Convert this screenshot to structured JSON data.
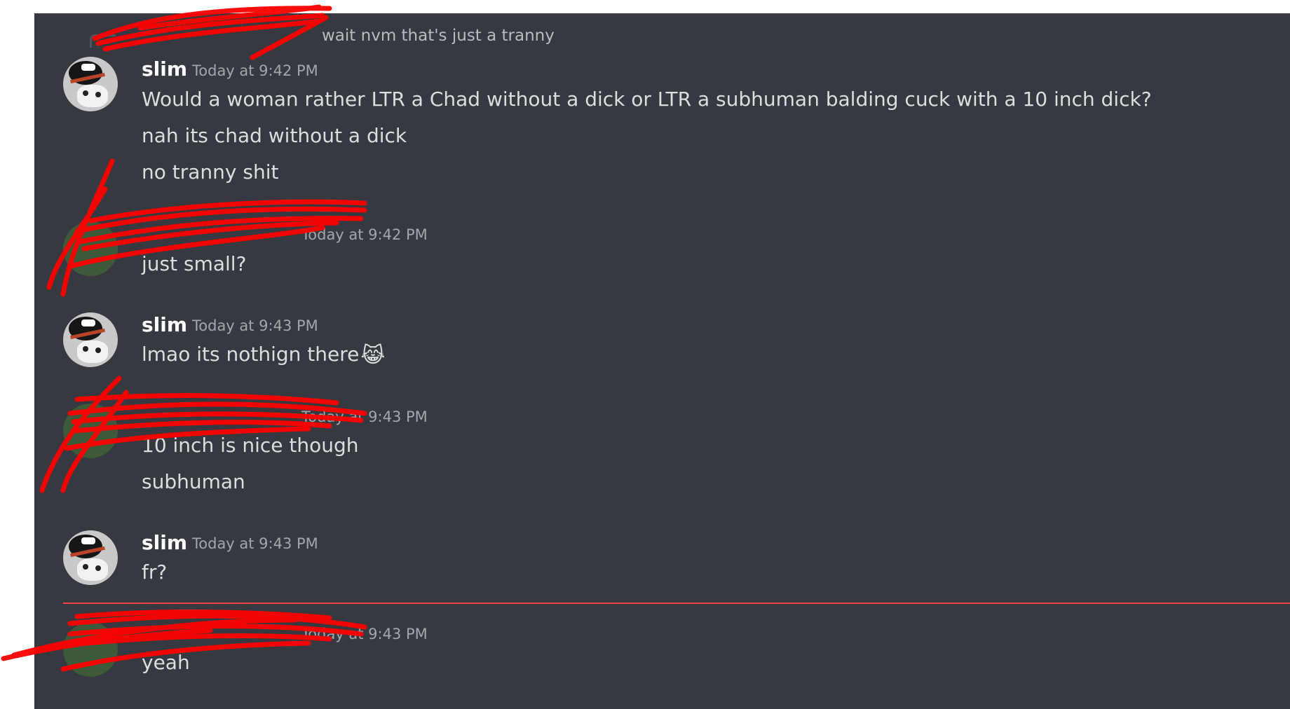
{
  "reply_preview": {
    "text": "wait nvm that's just a tranny"
  },
  "messages": [
    {
      "author": "slim",
      "timestamp": "Today at 9:42 PM",
      "lines": [
        "Would a woman rather LTR a Chad without a dick or LTR a subhuman balding cuck with a 10 inch dick?",
        "nah its chad without a dick",
        "no tranny shit"
      ]
    },
    {
      "author": "",
      "timestamp": "Today at 9:42 PM",
      "lines": [
        "just small?"
      ]
    },
    {
      "author": "slim",
      "timestamp": "Today at 9:43 PM",
      "lines": [
        "lmao its nothign there"
      ],
      "emoji": "😹"
    },
    {
      "author": "",
      "timestamp": "Today at 9:43 PM",
      "lines": [
        "10 inch is nice though",
        "subhuman"
      ]
    },
    {
      "author": "slim",
      "timestamp": "Today at 9:43 PM",
      "lines": [
        "fr?"
      ]
    },
    {
      "author": "",
      "timestamp": "Today at 9:43 PM",
      "lines": [
        "yeah"
      ]
    }
  ],
  "colors": {
    "background": "#36393f",
    "new_message_divider": "#ed4245",
    "redaction": "#ff0000"
  }
}
